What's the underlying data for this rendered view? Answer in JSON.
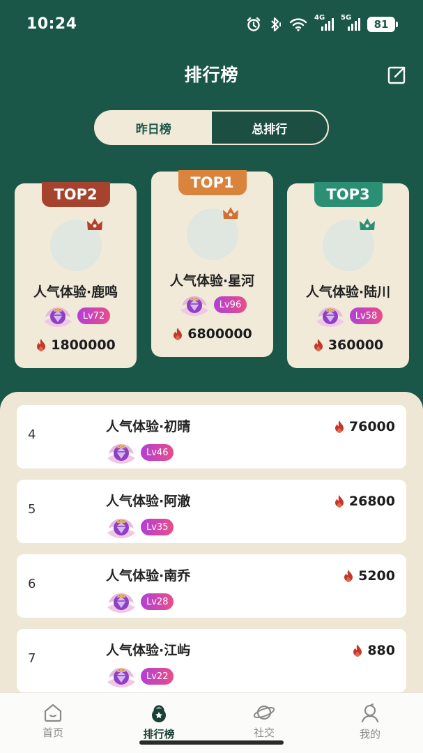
{
  "status_bar": {
    "time": "10:24",
    "network_4g": "4G",
    "network_5g": "5G",
    "battery": "81"
  },
  "header": {
    "title": "排行榜"
  },
  "tabs": [
    {
      "label": "昨日榜",
      "active": false
    },
    {
      "label": "总排行",
      "active": true
    }
  ],
  "podium": [
    {
      "badge": "TOP2",
      "badge_color": "#a5432f",
      "crown_color": "#b3402d",
      "name": "人气体验·鹿鸣",
      "level": "Lv72",
      "score": "1800000"
    },
    {
      "badge": "TOP1",
      "badge_color": "#d9833d",
      "crown_color": "#d36f31",
      "name": "人气体验·星河",
      "level": "Lv96",
      "score": "6800000"
    },
    {
      "badge": "TOP3",
      "badge_color": "#2b8f74",
      "crown_color": "#2c8e72",
      "name": "人气体验·陆川",
      "level": "Lv58",
      "score": "360000"
    }
  ],
  "ranking_list": [
    {
      "rank": "4",
      "name": "人气体验·初晴",
      "level": "Lv46",
      "score": "76000"
    },
    {
      "rank": "5",
      "name": "人气体验·阿澈",
      "level": "Lv35",
      "score": "26800"
    },
    {
      "rank": "6",
      "name": "人气体验·南乔",
      "level": "Lv28",
      "score": "5200"
    },
    {
      "rank": "7",
      "name": "人气体验·江屿",
      "level": "Lv22",
      "score": "880"
    }
  ],
  "bottom_nav": [
    {
      "label": "首页",
      "icon": "home-icon",
      "active": false
    },
    {
      "label": "排行榜",
      "icon": "kettlebell-icon",
      "active": true
    },
    {
      "label": "社交",
      "icon": "planet-icon",
      "active": false
    },
    {
      "label": "我的",
      "icon": "profile-icon",
      "active": false
    }
  ],
  "colors": {
    "background": "#1b5748",
    "sheet": "#efe7d5",
    "flame": "#c0392b",
    "level_gradient_start": "#b23fd6",
    "level_gradient_end": "#e84e88"
  }
}
